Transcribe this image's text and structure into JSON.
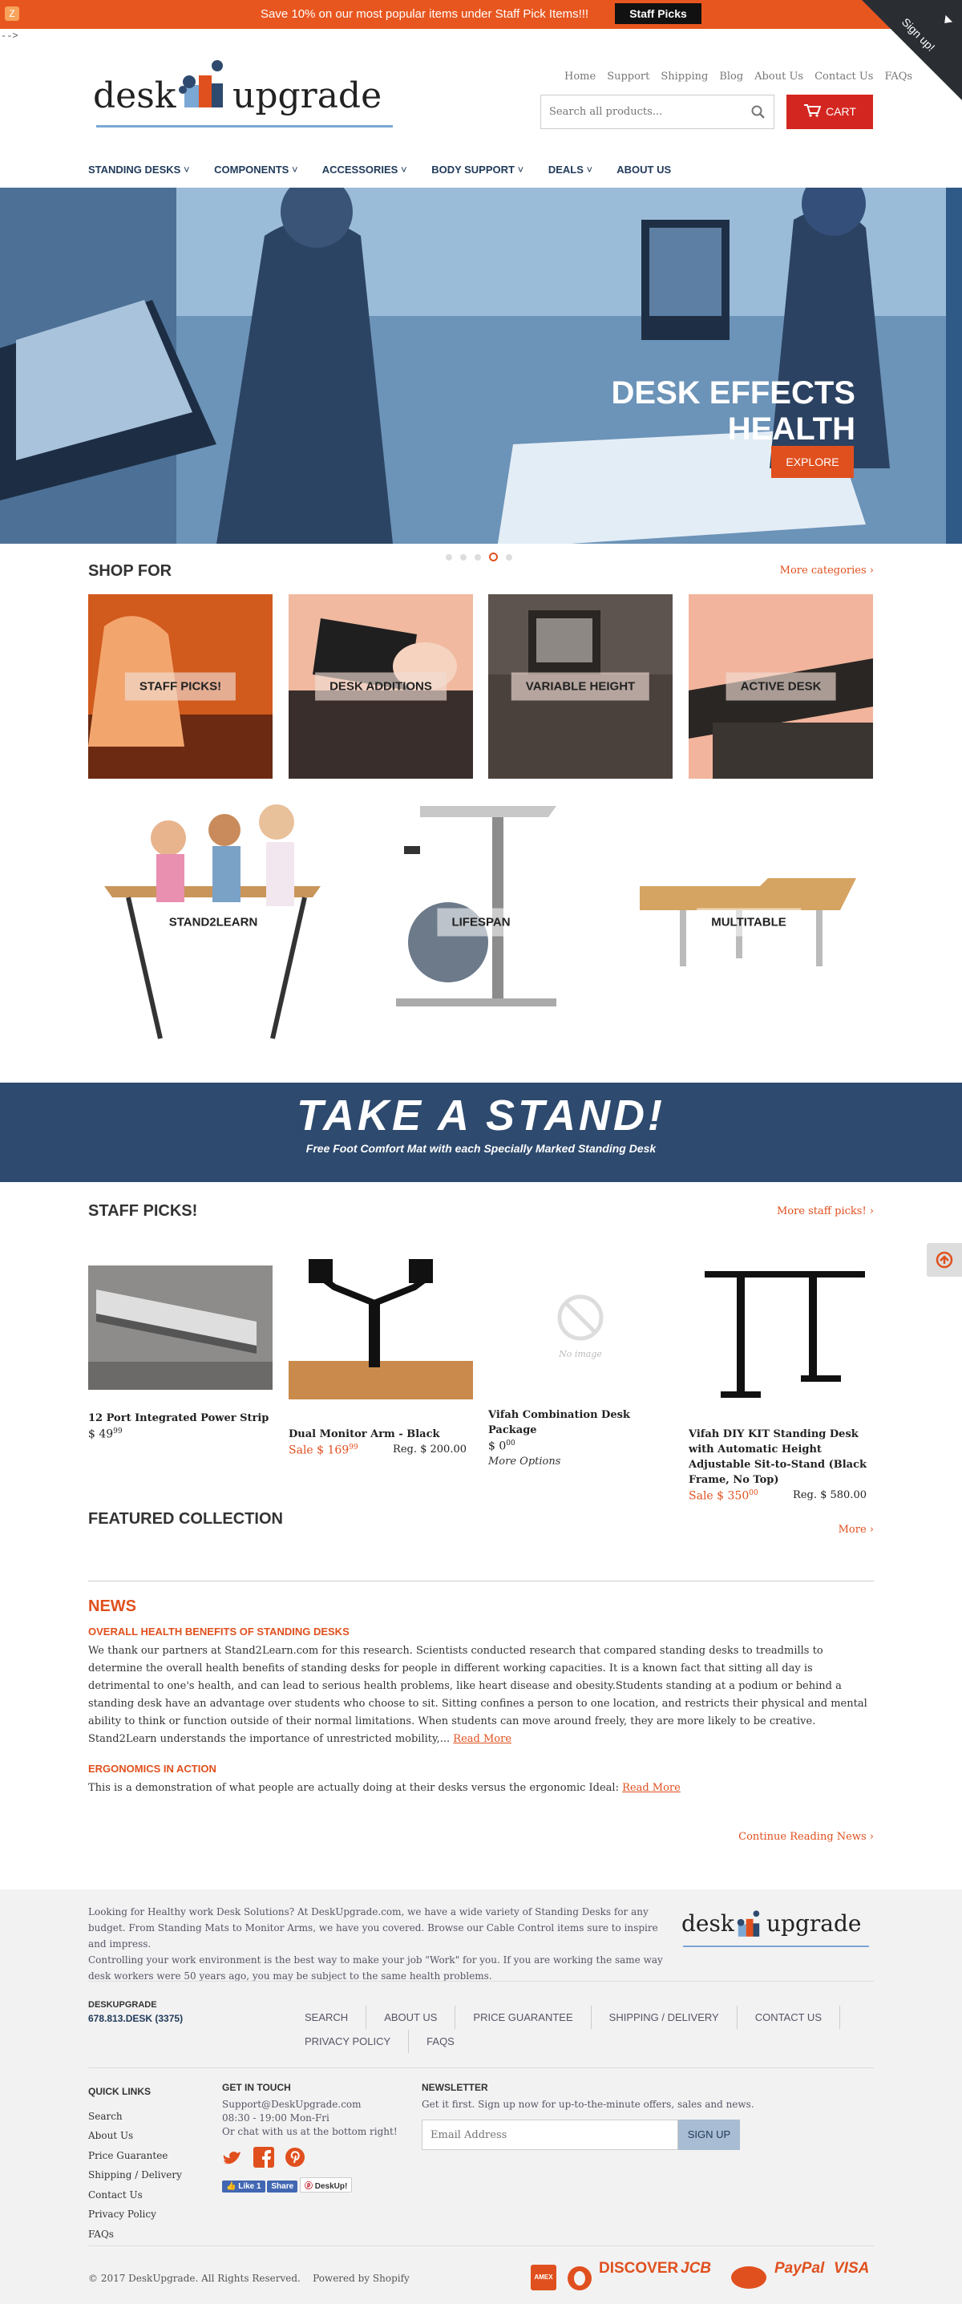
{
  "promo": {
    "text": "Save 10% on our most popular items under Staff Pick Items!!!",
    "button": "Staff Picks",
    "icon": "app-icon"
  },
  "signup": {
    "label": "Sign up!"
  },
  "stray_text": "-->",
  "logo": {
    "left": "desk",
    "right": "upgrade"
  },
  "top_links": [
    "Home",
    "Support",
    "Shipping",
    "Blog",
    "About Us",
    "Contact Us",
    "FAQs"
  ],
  "search": {
    "placeholder": "Search all products..."
  },
  "cart": {
    "label": "CART"
  },
  "nav": [
    {
      "label": "STANDING DESKS",
      "dropdown": true
    },
    {
      "label": "COMPONENTS",
      "dropdown": true
    },
    {
      "label": "ACCESSORIES",
      "dropdown": true
    },
    {
      "label": "BODY SUPPORT",
      "dropdown": true
    },
    {
      "label": "DEALS",
      "dropdown": true
    },
    {
      "label": "ABOUT US",
      "dropdown": false
    }
  ],
  "hero": {
    "title": "DESK EFFECTS HEALTH",
    "button": "EXPLORE",
    "slides": 5,
    "active_slide": 4
  },
  "shop_for": {
    "title": "SHOP FOR",
    "more": "More categories ›",
    "tiles": [
      "STAFF PICKS!",
      "DESK ADDITIONS",
      "VARIABLE HEIGHT",
      "ACTIVE DESK",
      "STAND2LEARN",
      "LIFESPAN",
      "MULTITABLE"
    ]
  },
  "banner": {
    "title": "TAKE A STAND!",
    "subtitle": "Free Foot Comfort Mat with each Specially Marked Standing Desk"
  },
  "staff_picks": {
    "title": "STAFF PICKS!",
    "more": "More staff picks! ›",
    "products": [
      {
        "title": "12 Port Integrated Power Strip",
        "price_main": "$ 49",
        "price_cents": "99",
        "sale": false,
        "reg": "",
        "note": ""
      },
      {
        "title": "Dual Monitor Arm - Black",
        "price_main": "Sale $ 169",
        "price_cents": "99",
        "sale": true,
        "reg": "Reg. $ 200.00",
        "note": ""
      },
      {
        "title": "Vifah Combination Desk Package",
        "price_main": "$ 0",
        "price_cents": "00",
        "sale": false,
        "reg": "",
        "note": "More Options",
        "image_text": "No image"
      },
      {
        "title": "Vifah DIY KIT Standing Desk with Automatic Height Adjustable Sit-to-Stand (Black Frame, No Top)",
        "price_main": "Sale $ 350",
        "price_cents": "00",
        "sale": true,
        "reg": "Reg. $ 580.00",
        "note": ""
      }
    ]
  },
  "featured": {
    "title": "FEATURED COLLECTION",
    "more": "More ›"
  },
  "news": {
    "title": "NEWS",
    "post1": {
      "title": "OVERALL HEALTH BENEFITS OF STANDING DESKS",
      "body": "We thank our partners at Stand2Learn.com for this research. Scientists conducted research that compared standing desks to treadmills to determine the overall health benefits of standing desks for people in different working capacities. It is a known fact that sitting all day is detrimental to one's health, and can lead to serious health problems, like heart disease and obesity.Students standing at a podium or behind a standing desk have an advantage over students who choose to sit. Sitting confines a person to one location, and restricts their physical and mental ability to think or function outside of their normal limitations. When students can move around freely, they are more likely to be creative. Stand2Learn understands the importance of unrestricted mobility,...",
      "read_more": "Read More"
    },
    "post2": {
      "title": "ERGONOMICS IN ACTION",
      "body": "This is a demonstration of what people are actually doing at their desks versus the ergonomic Ideal:",
      "read_more": "Read More"
    },
    "continue": "Continue Reading News ›"
  },
  "footer": {
    "about_line1": "Looking for Healthy work Desk Solutions? At DeskUpgrade.com, we have a wide variety of Standing Desks for any budget. From Standing Mats to Monitor Arms, we have you covered. Browse our Cable Control items sure to inspire and impress.",
    "about_line2": "Controlling your work environment is the best way to make your job \"Work\" for you. If you are working the same way desk workers were 50 years ago, you may be subject to the same health problems.",
    "company": "DESKUPGRADE",
    "phone": "678.813.DESK (3375)",
    "menu": [
      "SEARCH",
      "ABOUT US",
      "PRICE GUARANTEE",
      "SHIPPING / DELIVERY",
      "CONTACT US",
      "PRIVACY POLICY",
      "FAQS"
    ],
    "quick_links": {
      "title": "QUICK LINKS",
      "items": [
        "Search",
        "About Us",
        "Price Guarantee",
        "Shipping / Delivery",
        "Contact Us",
        "Privacy Policy",
        "FAQs"
      ]
    },
    "get_in_touch": {
      "title": "GET IN TOUCH",
      "email": "Support@DeskUpgrade.com",
      "hours": "08:30 - 19:00 Mon-Fri",
      "chat": "Or chat with us at the bottom right!",
      "fb_like": "Like 1",
      "fb_share": "Share",
      "pin": "DeskUp!"
    },
    "newsletter": {
      "title": "NEWSLETTER",
      "text": "Get it first. Sign up now for up-to-the-minute offers, sales and news.",
      "placeholder": "Email Address",
      "button": "SIGN UP"
    },
    "copyright": "© 2017 DeskUpgrade. All Rights Reserved.",
    "powered": "Powered by Shopify",
    "payments": [
      "american-express-icon",
      "diners-icon",
      "DISCOVER",
      "JCB",
      "master-icon",
      "PayPal",
      "VISA"
    ]
  },
  "colors": {
    "accent": "#e0501e",
    "promo_bg": "#e8561f",
    "nav": "#213b5b",
    "banner": "#2e4a6e",
    "cart": "#d42620"
  }
}
